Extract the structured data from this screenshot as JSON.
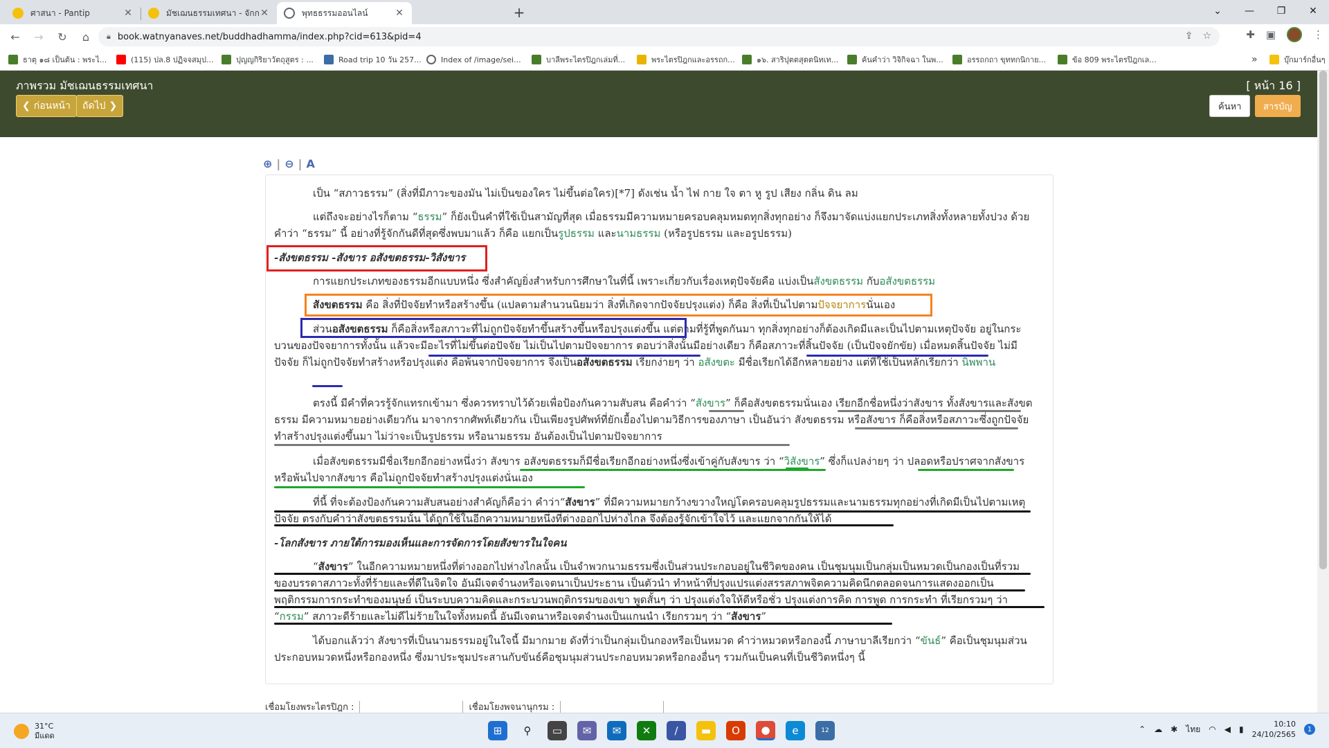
{
  "browser": {
    "tabs": [
      {
        "title": "ศาสนา - Pantip",
        "favicon_color": "#f4c20d",
        "active": false
      },
      {
        "title": "มัชเฌนธรรมเทศนา - จักกรัตติสูตร ,หา...",
        "favicon_color": "#f4c20d",
        "active": false
      },
      {
        "title": "พุทธธรรมออนไลน์",
        "favicon_color": "#5f6368",
        "active": true
      }
    ],
    "new_tab": "+",
    "url": "book.watnyanaves.net/buddhadhamma/index.php?cid=613&pid=4",
    "bookmarks": [
      {
        "label": "ธาตุ ๑๘ เป็นต้น : พระไ...",
        "icon_color": "#4a7d2a"
      },
      {
        "label": "(115) ปล.8 ปฏิจจสมุป...",
        "icon_color": "#ff0000"
      },
      {
        "label": "ปุญญกิริยาวัตถุสูตร : ...",
        "icon_color": "#4a7d2a"
      },
      {
        "label": "Road trip 10 วัน 257...",
        "icon_color": "#3a6ea5"
      },
      {
        "label": "Index of /image/sei...",
        "icon_color": "#5f6368"
      },
      {
        "label": "บาลีพระไตรปิฎกเล่มที่...",
        "icon_color": "#4a7d2a"
      },
      {
        "label": "พระไตรปิฎกและอรรถก...",
        "icon_color": "#e8b400"
      },
      {
        "label": "๑๖. สาริปุตตสุตตนิทเท...",
        "icon_color": "#4a7d2a"
      },
      {
        "label": "ค้นคำว่า วิจิกิจฉา ในพ...",
        "icon_color": "#4a7d2a"
      },
      {
        "label": "อรรถกถา ขุททกนิกาย...",
        "icon_color": "#4a7d2a"
      },
      {
        "label": "ข้อ 809 พระไตรปิฎกเล...",
        "icon_color": "#4a7d2a"
      }
    ],
    "bookmarks_more": "»",
    "bookmarks_folder": "บุ๊กมาร์กอื่นๆ"
  },
  "site": {
    "title": "ภาพรวม มัชเฌนธรรมเทศนา",
    "page_label": "[ หน้า 16 ]",
    "prev_label": "ก่อนหน้า",
    "next_label": "ถัดไป",
    "search_label": "ค้นหา",
    "toc_label": "สารบัญ"
  },
  "content": {
    "p1": "เป็น “สภาวธรรม” (สิ่งที่มีภาวะของมัน ไม่เป็นของใคร ไม่ขึ้นต่อใคร)[*7] ดังเช่น น้ำ ไฟ กาย ใจ ตา หู รูป เสียง กลิ่น ดิน ลม",
    "p2a": "แต่ถึงจะอย่างไรก็ตาม “",
    "p2_dhamma": "ธรรม",
    "p2b": "” ก็ยังเป็นคำที่ใช้เป็นสามัญที่สุด เมื่อธรรมมีความหมายครอบคลุมหมดทุกสิ่งทุกอย่าง ก็จึงมาจัดแบ่งแยกประเภทสิ่งทั้งหลายทั้งปวง ด้วยคำว่า “ธรรม” นี้ อย่างที่รู้จักกันดีที่สุดซึ่งพบมาแล้ว ก็คือ แยกเป็น",
    "p2_rupa": "รูปธรรม",
    "p2c": " และ",
    "p2_nama": "นามธรรม",
    "p2d": " (หรือรูปธรรม และอรูปธรรม)",
    "heading1": "-สังขตธรรม -สังขาร อสังขตธรรม-วิสังขาร",
    "p3a": "การแยกประเภทของธรรมอีกแบบหนึ่ง ซึ่งสำคัญยิ่งสำหรับการศึกษาในที่นี้ เพราะเกี่ยวกับเรื่องเหตุปัจจัยคือ แบ่งเป็น",
    "p3_sankhata": "สังขตธรรม",
    "p3b": " กับ",
    "p3_asankhata": "อสังขตธรรม",
    "p4_bold": "สังขตธรรม",
    "p4a": " คือ สิ่งที่ปัจจัยทำหรือสร้างขึ้น (แปลตามสำนวนนิยมว่า สิ่งที่เกิดจากปัจจัยปรุงแต่ง) ก็คือ สิ่งที่เป็นไปตาม",
    "p4_paccaya": "ปัจจยาการ",
    "p4b": "นั่นเอง",
    "p5a": "ส่วน",
    "p5_bold": "อสังขตธรรม",
    "p5b": " ก็คือสิ่งหรือสภาวะที่ไม่ถูกปัจจัยทำขึ้นสร้างขึ้นหรือปรุงแต่งขึ้น แต่ตามที่รู้ที่พูดกันมา ทุกสิ่งทุกอย่างก็ต้องเกิดมีและเป็นไปตามเหตุปัจจัย อยู่ในกระบวนของปัจจยาการทั้งนั้น แล้วจะมีอะไรที่ไม่ขึ้นต่อปัจจัย ไม่เป็นไปตามปัจจยาการ ตอบว่าสิ่งนั้นมีอย่างเดียว ก็คือสภาวะที่สิ้นปัจจัย (เป็นปัจจยักขัย) เมื่อหมดสิ้นปัจจัย ไม่มีปัจจัย ก็ไม่ถูกปัจจัยทำสร้างหรือปรุงแต่ง คือพ้นจากปัจจยาการ จึงเป็น",
    "p5_bold2": "อสังขตธรรม",
    "p5c": " เรียกง่ายๆ ว่า ",
    "p5_asankhata": "อสังขตะ",
    "p5d": " มีชื่อเรียกได้อีกหลายอย่าง แต่ที่ใช้เป็นหลักเรียกว่า ",
    "p5_nibbana": "นิพพาน",
    "p6a": "ตรงนี้ มีคำที่ควรรู้จักแทรกเข้ามา ซึ่งควรทราบไว้ด้วยเพื่อป้องกันความสับสน คือคำว่า “",
    "p6_sankhara": "สังขาร",
    "p6b": "” ก็คือสังขตธรรมนั่นเอง เรียกอีกชื่อหนึ่งว่าสังขาร ทั้งสังขารและสังขตธรรม มีความหมายอย่างเดียวกัน มาจากรากศัพท์เดียวกัน เป็นเพียงรูปศัพท์ที่ยักเยื้องไปตามวิธีการของภาษา เป็นอันว่า สังขตธรรม หรือสังขาร ก็คือสิ่งหรือสภาวะซึ่งถูกปัจจัยทำสร้างปรุงแต่งขึ้นมา ไม่ว่าจะเป็นรูปธรรม หรือนามธรรม อันต้องเป็นไปตามปัจจยาการ",
    "p7a": "เมื่อสังขตธรรมมีชื่อเรียกอีกอย่างหนึ่งว่า สังขาร อสังขตธรรมก็มีชื่อเรียกอีกอย่างหนึ่งซึ่งเข้าคู่กับสังขาร ว่า “",
    "p7_visankhara": "วิสังขาร",
    "p7b": "” ซึ่งก็แปลง่ายๆ ว่า ปลอดหรือปราศจากสังขาร หรือพ้นไปจากสังขาร คือไม่ถูกปัจจัยทำสร้างปรุงแต่งนั่นเอง",
    "p8a": "ที่นี้ ที่จะต้องป้องกันความสับสนอย่างสำคัญก็คือว่า คำว่า“",
    "p8_bold": "สังขาร",
    "p8b": "” ที่มีความหมายกว้างขวางใหญ่โตครอบคลุมรูปธรรมและนามธรรมทุกอย่างที่เกิดมีเป็นไปตามเหตุปัจจัย ตรงกับคำว่าสังขตธรรมนั้น ได้ถูกใช้ในอีกความหมายหนึ่งที่ต่างออกไปห่างไกล จึงต้องรู้จักเข้าใจไว้ และแยกจากกันให้ได้",
    "heading2": "-โลกสังขาร ภายใต้การมองเห็นและการจัดการโดยสังขารในใจคน",
    "p9a": "“",
    "p9_bold": "สังขาร",
    "p9b": "” ในอีกความหมายหนึ่งที่ต่างออกไปห่างไกลนั้น เป็นจำพวกนามธรรมซึ่งเป็นส่วนประกอบอยู่ในชีวิตของคน เป็นชุมนุมเป็นกลุ่มเป็นหมวดเป็นกองเป็นที่รวมของบรรดาสภาวะทั้งที่ร้ายและที่ดีในจิตใจ อันมีเจตจำนงหรือเจตนาเป็นประธาน เป็นตัวนำ ทำหน้าที่ปรุงแปรแต่งสรรสภาพจิตความคิดนึกตลอดจนการแสดงออกเป็นพฤติกรรมการกระทำของมนุษย์ เป็นระบบความคิดและกระบวนพฤติกรรมของเขา พูดสั้นๆ ว่า ปรุงแต่งใจให้ดีหรือชั่ว ปรุงแต่งการคิด การพูด การกระทำ ที่เรียกรวมๆ ว่า “",
    "p9_kamma": "กรรม",
    "p9c": "” สภาวะดีร้ายและไม่ดีไม่ร้ายในใจทั้งหมดนี้ อันมีเจตนาหรือเจตจำนงเป็นแกนนำ เรียกรวมๆ ว่า “",
    "p9_bold2": "สังขาร",
    "p9d": "”",
    "p10a": "ได้บอกแล้วว่า สังขารที่เป็นนามธรรมอยู่ในใจนี้ มีมากมาย ดังที่ว่าเป็นกลุ่มเป็นกองหรือเป็นหมวด คำว่าหมวดหรือกองนี้ ภาษาบาลีเรียกว่า “",
    "p10_khandha": "ขันธ์",
    "p10b": "” คือเป็นชุมนุมส่วนประกอบหมวดหนึ่งหรือกองหนึ่ง ซึ่งมาประชุมประสานกับขันธ์คือชุมนุมส่วนประกอบหมวดหรือกองอื่นๆ รวมกันเป็นคนที่เป็นชีวิตหนึ่งๆ นี้"
  },
  "bottom": {
    "link1_label": "เชื่อมโยงพระไตรปิฎก :",
    "link2_label": "เชื่อมโยงพจนานุกรม :"
  },
  "annotation_colors": {
    "red": "#e02020",
    "orange": "#f58220",
    "blue": "#2b2bb0",
    "gray": "#7a7a7a",
    "green": "#1ea82a",
    "black": "#111111"
  },
  "taskbar": {
    "weather_temp": "31°C",
    "weather_desc": "มีแดด",
    "lang": "ไทย",
    "time": "10:10",
    "date": "24/10/2565",
    "notification_count": "1",
    "badge": "12"
  }
}
